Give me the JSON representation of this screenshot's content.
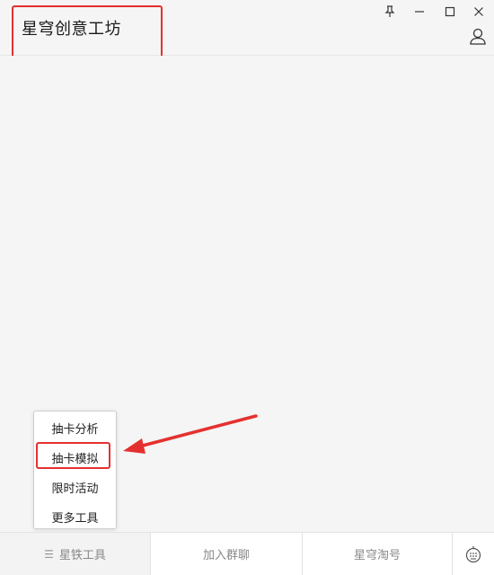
{
  "app": {
    "title": "星穹创意工坊"
  },
  "window_controls": {
    "pin": "pin-icon",
    "minimize": "minimize-icon",
    "maximize": "maximize-icon",
    "close": "close-icon",
    "user": "user-icon"
  },
  "popup_menu": {
    "items": [
      {
        "label": "抽卡分析"
      },
      {
        "label": "抽卡模拟",
        "highlighted": true
      },
      {
        "label": "限时活动"
      },
      {
        "label": "更多工具"
      }
    ]
  },
  "bottom_tabs": {
    "items": [
      {
        "label": "星铁工具",
        "icon": "menu-lines-icon",
        "active": true
      },
      {
        "label": "加入群聊"
      },
      {
        "label": "星穹淘号"
      },
      {
        "label": "",
        "icon": "emoji-icon"
      }
    ]
  },
  "annotations": {
    "highlight_color": "#e53030"
  }
}
